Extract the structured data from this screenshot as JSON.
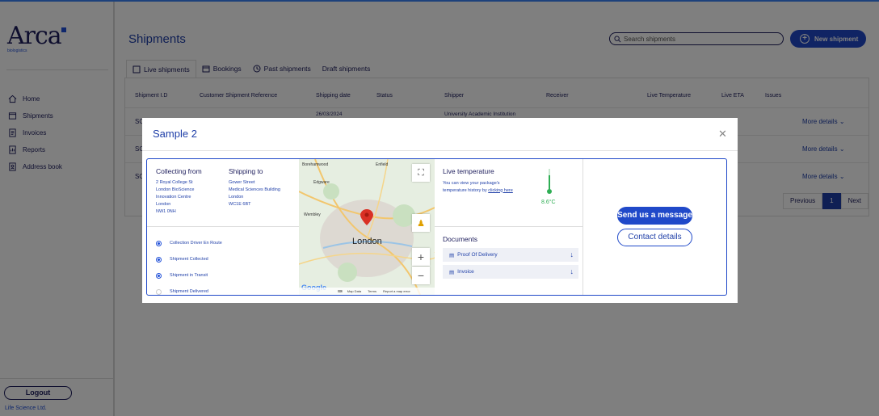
{
  "brand": {
    "logo_text": "Arca",
    "logo_sub": "biologistics",
    "company": "Life Science Ltd."
  },
  "sidebar": {
    "items": [
      {
        "label": "Home",
        "icon": "home-icon"
      },
      {
        "label": "Shipments",
        "icon": "shipments-icon"
      },
      {
        "label": "Invoices",
        "icon": "invoice-icon"
      },
      {
        "label": "Reports",
        "icon": "report-icon"
      },
      {
        "label": "Address book",
        "icon": "address-book-icon"
      }
    ],
    "logout_label": "Logout"
  },
  "header": {
    "title": "Shipments",
    "search_placeholder": "Search shipments",
    "new_button": "New shipment"
  },
  "tabs": [
    "Live shipments",
    "Bookings",
    "Past shipments",
    "Draft shipments"
  ],
  "table": {
    "columns": [
      "Shipment I.D",
      "Customer Shipment Reference",
      "Shipping date",
      "Status",
      "Shipper",
      "Receiver",
      "Live Temperature",
      "Live ETA",
      "Issues"
    ],
    "rows": [
      {
        "id": "SO",
        "date": "26/03/2024",
        "shipper": "University Academic Institution",
        "more": "More details"
      },
      {
        "id": "SO",
        "more": "More details"
      },
      {
        "id": "SO",
        "more": "More details"
      }
    ]
  },
  "pagination": {
    "previous": "Previous",
    "page": "1",
    "next": "Next"
  },
  "modal": {
    "title": "Sample 2",
    "collecting_from": {
      "heading": "Collecting from",
      "lines": [
        "2 Royal College St",
        "London BioScience",
        "Innovation Centre",
        "London",
        "NW1 0NH"
      ]
    },
    "shipping_to": {
      "heading": "Shipping to",
      "lines": [
        "Gower Street",
        "Medical Sciences Building",
        "London",
        "WC1E 6BT"
      ]
    },
    "steps": [
      {
        "label": "Collection Driver En Route",
        "state": "done"
      },
      {
        "label": "Shipment Collected",
        "state": "done"
      },
      {
        "label": "Shipment in Transit",
        "state": "done"
      },
      {
        "label": "Shipment Delivered",
        "state": "pending"
      }
    ],
    "map": {
      "city": "London",
      "places": [
        "Borehamwood",
        "Enfield",
        "Edgware",
        "Wembley"
      ],
      "footer": [
        "Map Data",
        "Terms",
        "Report a map error"
      ],
      "logo": "Google"
    },
    "live_temperature": {
      "heading": "Live temperature",
      "text": "You can view your package's temperature history by",
      "link": "clicking here",
      "value": "8.6°C"
    },
    "documents": {
      "heading": "Documents",
      "items": [
        "Proof Of Delivery",
        "Invoice"
      ]
    },
    "send_button": "Send us a message",
    "contact_button": "Contact details"
  },
  "colors": {
    "primary": "#2049c9",
    "text": "#1d1d5c",
    "temp": "#2fae54"
  }
}
